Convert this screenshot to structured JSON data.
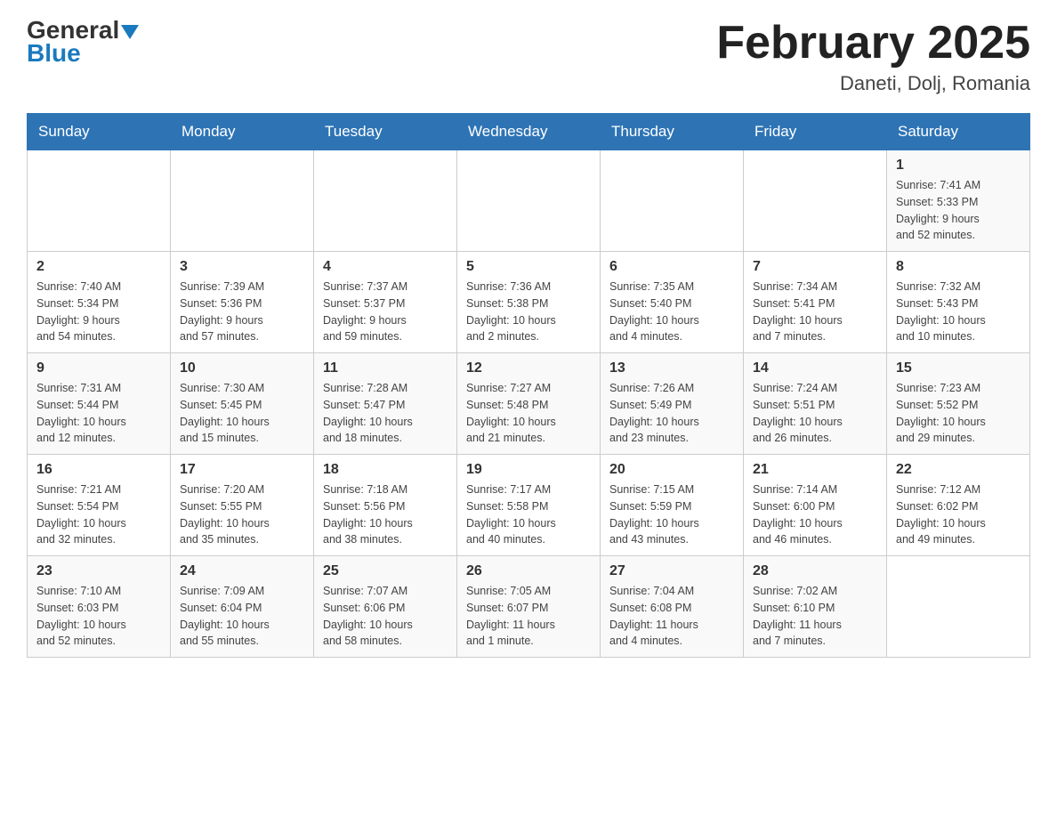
{
  "header": {
    "logo_general": "General",
    "logo_blue": "Blue",
    "month_title": "February 2025",
    "location": "Daneti, Dolj, Romania"
  },
  "weekdays": [
    "Sunday",
    "Monday",
    "Tuesday",
    "Wednesday",
    "Thursday",
    "Friday",
    "Saturday"
  ],
  "rows": [
    [
      {
        "day": "",
        "info": ""
      },
      {
        "day": "",
        "info": ""
      },
      {
        "day": "",
        "info": ""
      },
      {
        "day": "",
        "info": ""
      },
      {
        "day": "",
        "info": ""
      },
      {
        "day": "",
        "info": ""
      },
      {
        "day": "1",
        "info": "Sunrise: 7:41 AM\nSunset: 5:33 PM\nDaylight: 9 hours\nand 52 minutes."
      }
    ],
    [
      {
        "day": "2",
        "info": "Sunrise: 7:40 AM\nSunset: 5:34 PM\nDaylight: 9 hours\nand 54 minutes."
      },
      {
        "day": "3",
        "info": "Sunrise: 7:39 AM\nSunset: 5:36 PM\nDaylight: 9 hours\nand 57 minutes."
      },
      {
        "day": "4",
        "info": "Sunrise: 7:37 AM\nSunset: 5:37 PM\nDaylight: 9 hours\nand 59 minutes."
      },
      {
        "day": "5",
        "info": "Sunrise: 7:36 AM\nSunset: 5:38 PM\nDaylight: 10 hours\nand 2 minutes."
      },
      {
        "day": "6",
        "info": "Sunrise: 7:35 AM\nSunset: 5:40 PM\nDaylight: 10 hours\nand 4 minutes."
      },
      {
        "day": "7",
        "info": "Sunrise: 7:34 AM\nSunset: 5:41 PM\nDaylight: 10 hours\nand 7 minutes."
      },
      {
        "day": "8",
        "info": "Sunrise: 7:32 AM\nSunset: 5:43 PM\nDaylight: 10 hours\nand 10 minutes."
      }
    ],
    [
      {
        "day": "9",
        "info": "Sunrise: 7:31 AM\nSunset: 5:44 PM\nDaylight: 10 hours\nand 12 minutes."
      },
      {
        "day": "10",
        "info": "Sunrise: 7:30 AM\nSunset: 5:45 PM\nDaylight: 10 hours\nand 15 minutes."
      },
      {
        "day": "11",
        "info": "Sunrise: 7:28 AM\nSunset: 5:47 PM\nDaylight: 10 hours\nand 18 minutes."
      },
      {
        "day": "12",
        "info": "Sunrise: 7:27 AM\nSunset: 5:48 PM\nDaylight: 10 hours\nand 21 minutes."
      },
      {
        "day": "13",
        "info": "Sunrise: 7:26 AM\nSunset: 5:49 PM\nDaylight: 10 hours\nand 23 minutes."
      },
      {
        "day": "14",
        "info": "Sunrise: 7:24 AM\nSunset: 5:51 PM\nDaylight: 10 hours\nand 26 minutes."
      },
      {
        "day": "15",
        "info": "Sunrise: 7:23 AM\nSunset: 5:52 PM\nDaylight: 10 hours\nand 29 minutes."
      }
    ],
    [
      {
        "day": "16",
        "info": "Sunrise: 7:21 AM\nSunset: 5:54 PM\nDaylight: 10 hours\nand 32 minutes."
      },
      {
        "day": "17",
        "info": "Sunrise: 7:20 AM\nSunset: 5:55 PM\nDaylight: 10 hours\nand 35 minutes."
      },
      {
        "day": "18",
        "info": "Sunrise: 7:18 AM\nSunset: 5:56 PM\nDaylight: 10 hours\nand 38 minutes."
      },
      {
        "day": "19",
        "info": "Sunrise: 7:17 AM\nSunset: 5:58 PM\nDaylight: 10 hours\nand 40 minutes."
      },
      {
        "day": "20",
        "info": "Sunrise: 7:15 AM\nSunset: 5:59 PM\nDaylight: 10 hours\nand 43 minutes."
      },
      {
        "day": "21",
        "info": "Sunrise: 7:14 AM\nSunset: 6:00 PM\nDaylight: 10 hours\nand 46 minutes."
      },
      {
        "day": "22",
        "info": "Sunrise: 7:12 AM\nSunset: 6:02 PM\nDaylight: 10 hours\nand 49 minutes."
      }
    ],
    [
      {
        "day": "23",
        "info": "Sunrise: 7:10 AM\nSunset: 6:03 PM\nDaylight: 10 hours\nand 52 minutes."
      },
      {
        "day": "24",
        "info": "Sunrise: 7:09 AM\nSunset: 6:04 PM\nDaylight: 10 hours\nand 55 minutes."
      },
      {
        "day": "25",
        "info": "Sunrise: 7:07 AM\nSunset: 6:06 PM\nDaylight: 10 hours\nand 58 minutes."
      },
      {
        "day": "26",
        "info": "Sunrise: 7:05 AM\nSunset: 6:07 PM\nDaylight: 11 hours\nand 1 minute."
      },
      {
        "day": "27",
        "info": "Sunrise: 7:04 AM\nSunset: 6:08 PM\nDaylight: 11 hours\nand 4 minutes."
      },
      {
        "day": "28",
        "info": "Sunrise: 7:02 AM\nSunset: 6:10 PM\nDaylight: 11 hours\nand 7 minutes."
      },
      {
        "day": "",
        "info": ""
      }
    ]
  ]
}
